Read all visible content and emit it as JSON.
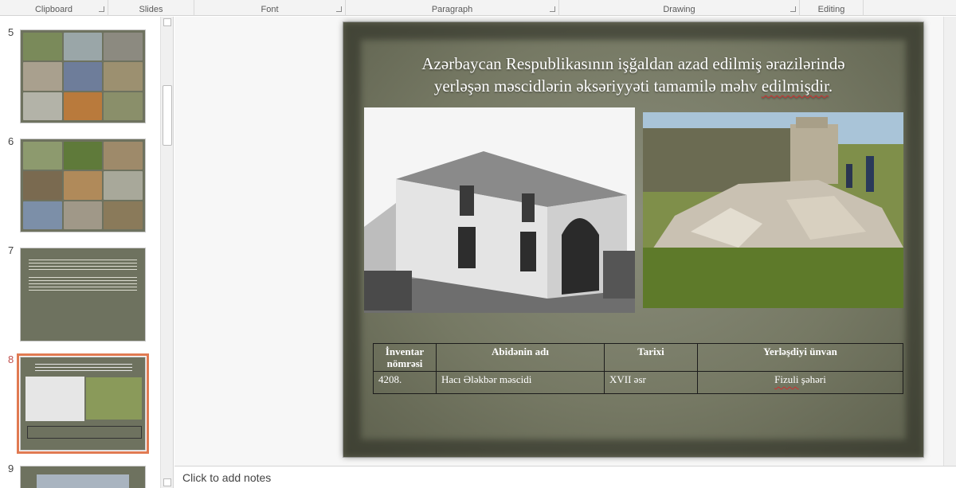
{
  "ribbon": {
    "groups": [
      {
        "label": "Clipboard"
      },
      {
        "label": "Slides"
      },
      {
        "label": "Font"
      },
      {
        "label": "Paragraph"
      },
      {
        "label": "Drawing"
      },
      {
        "label": "Editing"
      }
    ]
  },
  "thumbnails": {
    "items": [
      {
        "number": "5"
      },
      {
        "number": "6"
      },
      {
        "number": "7"
      },
      {
        "number": "8",
        "selected": true
      },
      {
        "number": "9"
      }
    ]
  },
  "slide": {
    "title_line1": "Azərbaycan Respublikasının işğaldan azad edilmiş ərazilərində",
    "title_line2_a": "yerləşən məscidlərin əksəriyyəti tamamilə məhv ",
    "title_line2_b": "edilmişdir",
    "title_line2_c": ".",
    "table": {
      "headers": [
        "İnventar nömrəsi",
        "Abidənin adı",
        "Tarixi",
        "Yerləşdiyi ünvan"
      ],
      "rows": [
        {
          "inventory": "4208.",
          "name": "Hacı Ələkbər məscidi",
          "date": "XVII əsr",
          "address_a": "Fizuli",
          "address_b": " şəhəri"
        }
      ]
    }
  },
  "notes": {
    "placeholder": "Click to add notes"
  },
  "colors": {
    "selection_outline": "#e07a52",
    "slide_bg": "#767964",
    "spell_error": "#d03030"
  }
}
